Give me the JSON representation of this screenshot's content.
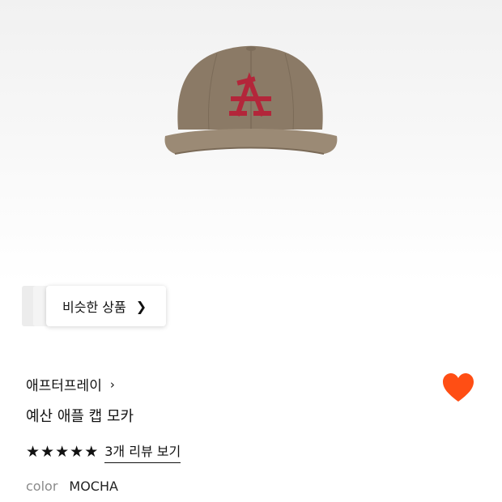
{
  "similar": {
    "label": "비슷한 상품",
    "chevron_icon": "chevron-right-icon"
  },
  "product": {
    "brand": "애프터프레이",
    "name": "예산 애플 캡 모카",
    "rating_stars": 5,
    "review_link": "3개 리뷰 보기",
    "color_label": "color",
    "color_value": "MOCHA"
  },
  "colors": {
    "heart": "#ff4e14",
    "cap": "#8b7a66",
    "logo": "#b3263a"
  }
}
